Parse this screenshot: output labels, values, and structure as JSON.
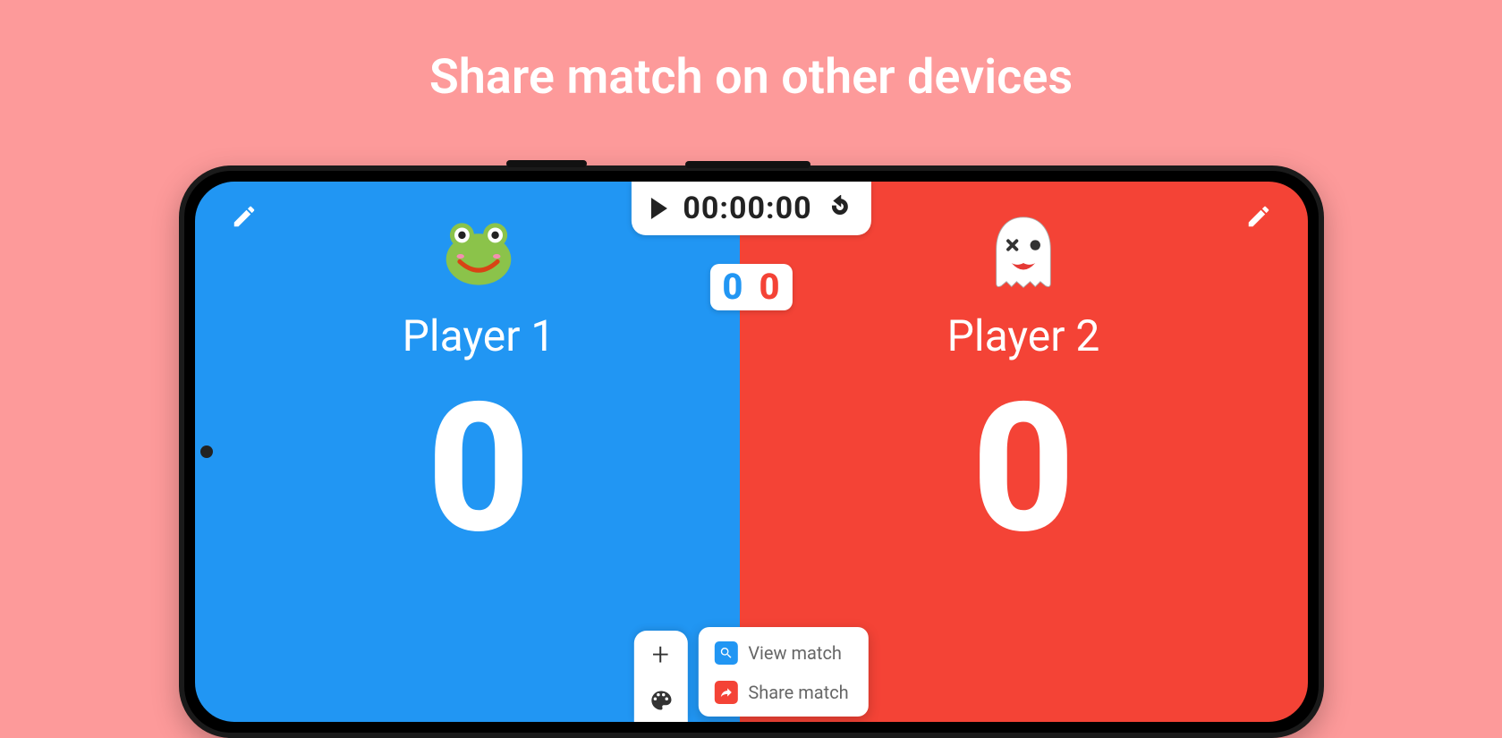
{
  "headline": "Share match on other devices",
  "timer": {
    "time": "00:00:00"
  },
  "mini": {
    "blue": "0",
    "red": "0"
  },
  "players": {
    "p1": {
      "name": "Player 1",
      "score": "0",
      "avatar": "frog"
    },
    "p2": {
      "name": "Player 2",
      "score": "0",
      "avatar": "ghost"
    }
  },
  "popup": {
    "view": "View match",
    "share": "Share match"
  },
  "colors": {
    "blue": "#2196F3",
    "red": "#F44336",
    "bg": "#FD9A9A"
  }
}
